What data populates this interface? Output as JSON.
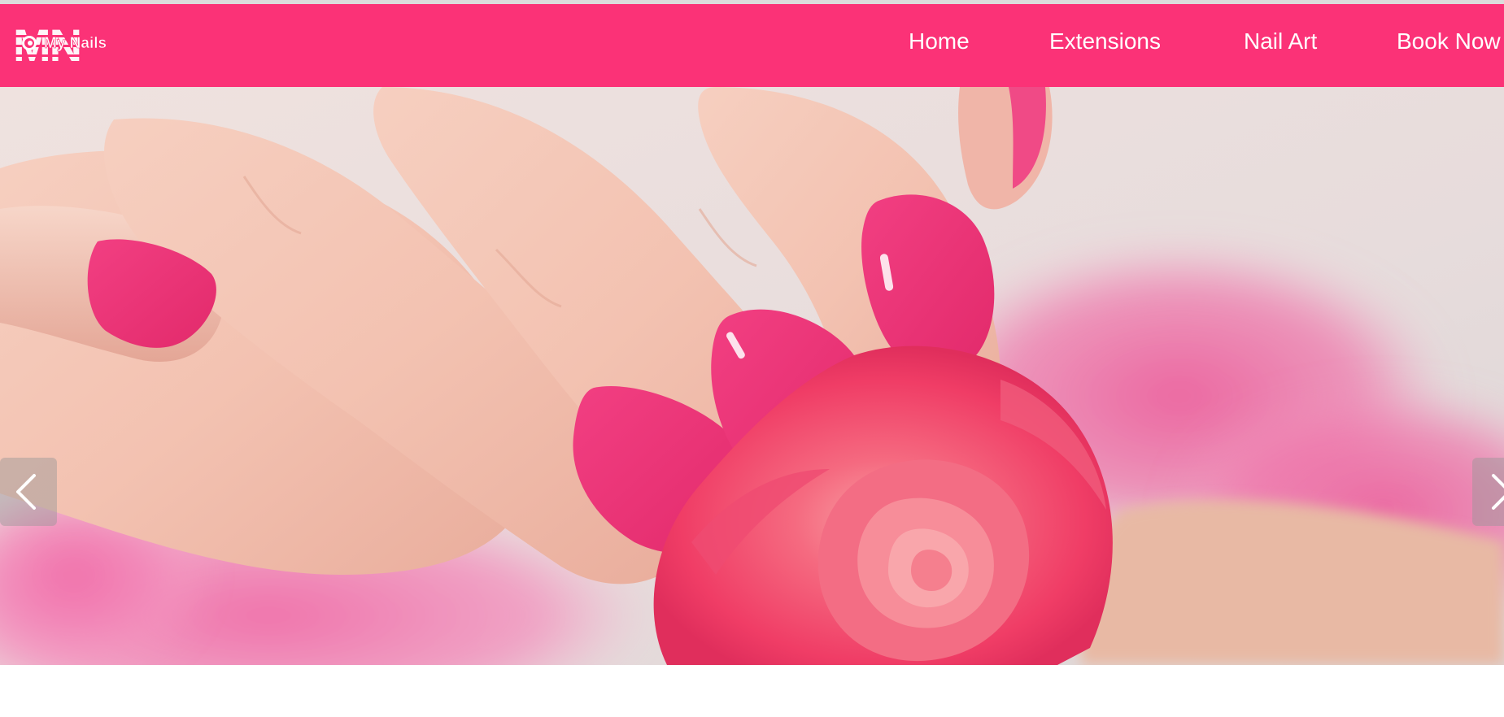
{
  "brand": {
    "logo_monogram": "MN",
    "logo_text": "My Nails"
  },
  "nav": {
    "items": [
      {
        "label": "Home"
      },
      {
        "label": "Extensions"
      },
      {
        "label": "Nail Art"
      },
      {
        "label": "Book Now"
      }
    ]
  },
  "hero": {
    "image": "pink-manicured-hand-holding-rose",
    "prev_icon": "chevron-left-icon",
    "next_icon": "chevron-right-icon"
  },
  "colors": {
    "brand_pink": "#fb3277",
    "nail_pink": "#f0357a",
    "rose_pink": "#f24a6f",
    "white": "#ffffff"
  }
}
